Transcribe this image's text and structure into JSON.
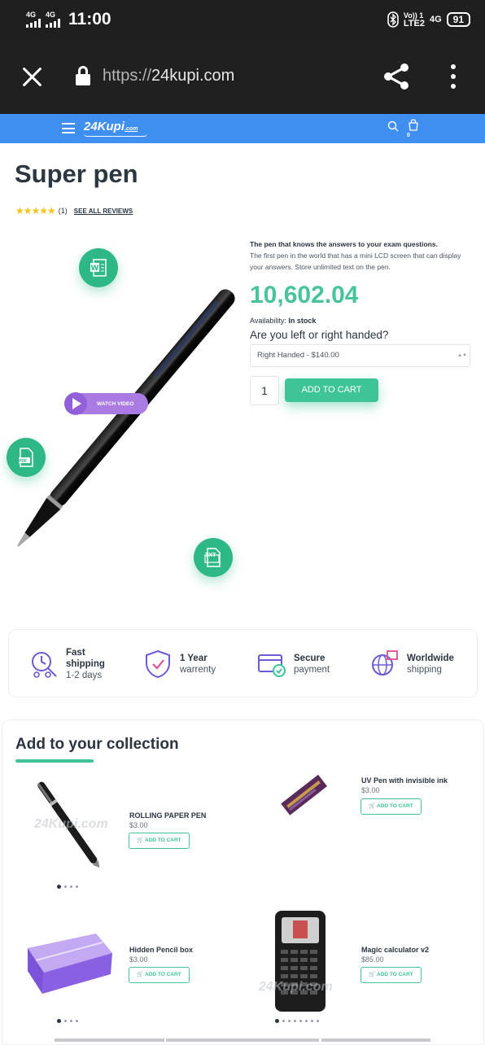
{
  "status_bar": {
    "net1": "4G",
    "net2": "4G",
    "time": "11:00",
    "volte": "Vo)) 1",
    "lte": "LTE2",
    "net3": "4G",
    "battery": "91"
  },
  "browser": {
    "url_proto": "https://",
    "url_host": "24kupi.com"
  },
  "site_header": {
    "logo": "24Kupi",
    "logo_small": ".com",
    "cart_count": "0"
  },
  "product": {
    "title": "Super pen",
    "stars": "★★★★★",
    "review_count": "(1)",
    "see_reviews": "SEE ALL REVIEWS",
    "tagline": "The pen that knows the answers to your exam questions.",
    "description": "The first pen in the world that has a mini LCD screen that can display your answers. Store unlimited text on the pen.",
    "price": "10,602.04",
    "availability_label": "Availability:",
    "availability_value": "In stock",
    "hand_question": "Are you left or right handed?",
    "hand_selected": "Right Handed - $140.00",
    "quantity": "1",
    "add_to_cart": "ADD TO CART",
    "watch_video": "WATCH VIDEO",
    "badge_pdf": "PDF",
    "badge_txt": "TXT"
  },
  "benefits": [
    {
      "title": "Fast",
      "title2": "shipping",
      "sub": "1-2 days"
    },
    {
      "title": "1 Year",
      "sub": "warrenty"
    },
    {
      "title": "Secure",
      "sub": "payment"
    },
    {
      "title": "Worldwide",
      "sub": "shipping"
    }
  ],
  "collection": {
    "title": "Add to your collection",
    "button_label": "ADD TO CART",
    "items": [
      {
        "name": "ROLLING PAPER PEN",
        "price": "$3.00"
      },
      {
        "name": "UV Pen with invisible ink",
        "price": "$3.00"
      },
      {
        "name": "Hidden Pencil box",
        "price": "$3.00"
      },
      {
        "name": "Magic calculator v2",
        "price": "$85.00"
      }
    ],
    "watermark": "24Kupi.com"
  },
  "colors": {
    "accent": "#3fc497",
    "header_blue": "#3f8ff0",
    "video_purple": "#a97be3",
    "star": "#f6c31b"
  }
}
